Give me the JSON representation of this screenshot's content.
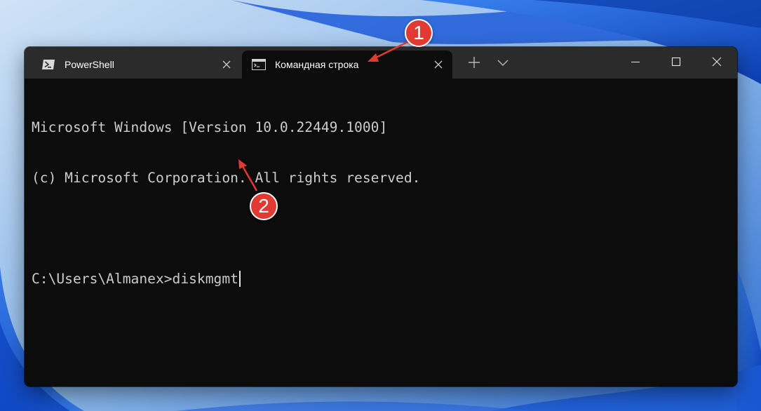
{
  "tabs": [
    {
      "label": "PowerShell",
      "icon": "powershell-icon",
      "active": false
    },
    {
      "label": "Командная строка",
      "icon": "command-prompt-icon",
      "active": true
    }
  ],
  "toolbar": {
    "new_tab_icon": "plus-icon",
    "dropdown_icon": "chevron-down-icon"
  },
  "window_controls": [
    "minimize-icon",
    "maximize-icon",
    "close-icon"
  ],
  "console": {
    "lines": [
      "Microsoft Windows [Version 10.0.22449.1000]",
      "(c) Microsoft Corporation. All rights reserved.",
      ""
    ],
    "prompt": "C:\\Users\\Almanex>",
    "input": "diskmgmt"
  },
  "annotations": [
    {
      "number": "1"
    },
    {
      "number": "2"
    }
  ],
  "colors": {
    "annotation": "#e03a33",
    "console_bg": "#0c0c0c",
    "titlebar_bg": "#2b2b2b",
    "console_text": "#cccccc"
  }
}
